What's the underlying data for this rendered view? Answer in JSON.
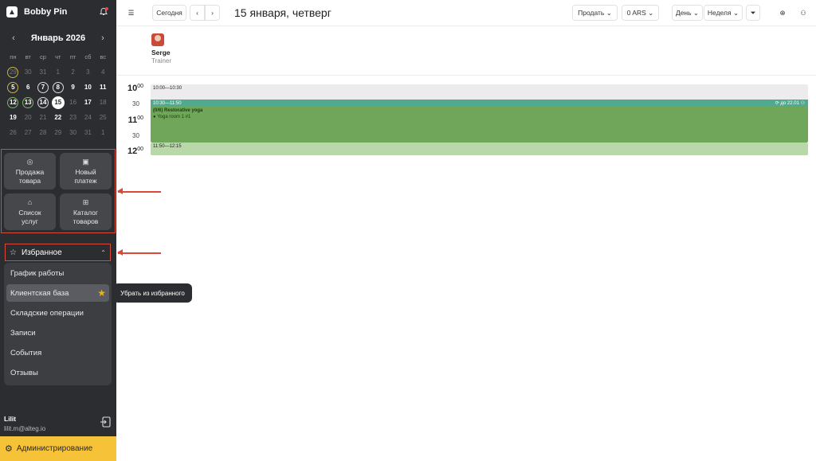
{
  "sidebar": {
    "brand": "Bobby Pin",
    "calendar": {
      "month_title": "Январь 2026",
      "weekdays": [
        "пн",
        "вт",
        "ср",
        "чт",
        "пт",
        "сб",
        "вс"
      ],
      "weeks": [
        [
          "29",
          "30",
          "31",
          "1",
          "2",
          "3",
          "4"
        ],
        [
          "5",
          "6",
          "7",
          "8",
          "9",
          "10",
          "11"
        ],
        [
          "12",
          "13",
          "14",
          "15",
          "16",
          "17",
          "18"
        ],
        [
          "19",
          "20",
          "21",
          "22",
          "23",
          "24",
          "25"
        ],
        [
          "26",
          "27",
          "28",
          "29",
          "30",
          "31",
          "1"
        ]
      ]
    },
    "quick_actions": [
      "Продажа товара",
      "Новый платеж",
      "Список услуг",
      "Каталог товаров"
    ],
    "favorites_title": "Избранное",
    "favorites": [
      "График работы",
      "Клиентская база",
      "Складские операции",
      "Записи",
      "События",
      "Отзывы"
    ],
    "tooltip": "Убрать из избранного",
    "user_name": "Lilit",
    "user_email": "lilit.m@alteg.io",
    "admin_label": "Администрирование"
  },
  "topbar": {
    "today": "Сегодня",
    "date_title": "15 января, четверг",
    "sell": "Продать",
    "currency": "0 ARS",
    "day": "День",
    "week": "Неделя"
  },
  "resource": {
    "name": "Serge",
    "role": "Trainer"
  },
  "times": {
    "h10": "10",
    "h11": "11",
    "h12": "12",
    "m00": "00",
    "m30": "30"
  },
  "events": {
    "e1": "10:00—10:30",
    "e2_time": "10:30—11:50",
    "e2_right": "до 22.01",
    "e2_title": "(0/6) Restorative yoga",
    "e2_room": "Yoga room 1 #1",
    "e3": "11:50—12:15"
  },
  "colors": {
    "accent": "#f6c238",
    "highlight": "#d94a3a",
    "event_green": "#6fa65a",
    "event_teal": "#4faa8e"
  }
}
